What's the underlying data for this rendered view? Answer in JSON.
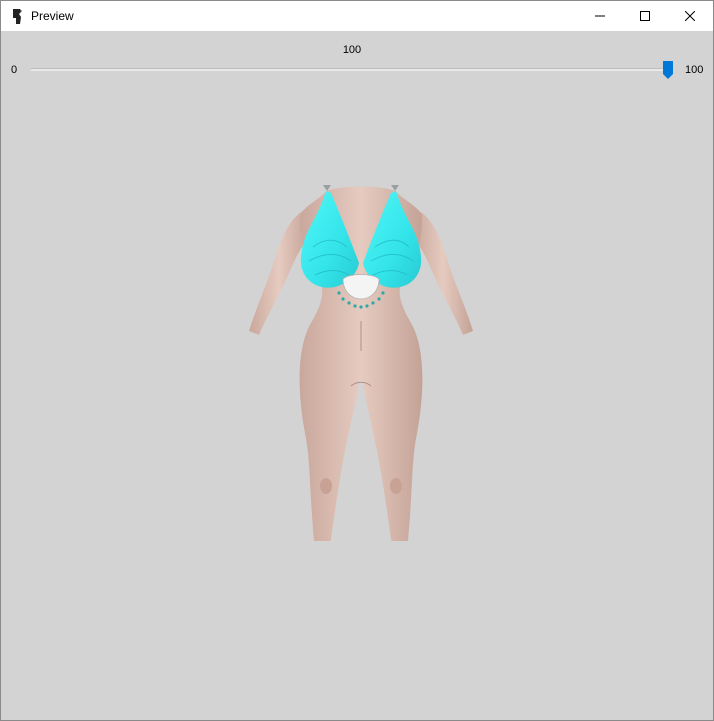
{
  "window": {
    "title": "Preview",
    "controls": {
      "minimize": "minimize-icon",
      "maximize": "maximize-icon",
      "close": "close-icon"
    }
  },
  "slider": {
    "value_label": "100",
    "min_label": "0",
    "max_label": "100",
    "value": 100,
    "min": 0,
    "max": 100,
    "thumb_color": "#0078d7"
  },
  "preview": {
    "background_color": "#d3d3d3",
    "subject": "3D body model preview",
    "top_color": "#40f0f0",
    "skin_color": "#dcbcb0"
  }
}
